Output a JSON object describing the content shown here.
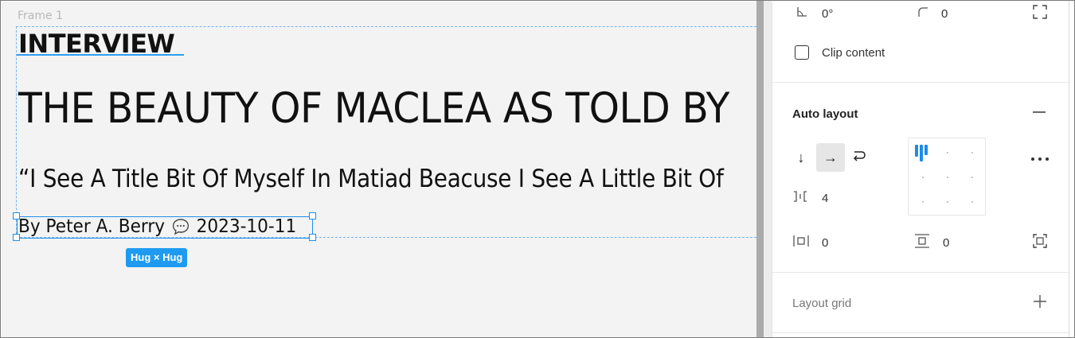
{
  "canvas": {
    "frame_label": "Frame 1",
    "kicker": "INTERVIEW",
    "headline": "THE BEAUTY OF MACLEA AS TOLD BY",
    "quote": "“I See A Title Bit Of Myself In Matiad Beacuse I See A Little Bit Of",
    "byline": {
      "author": "By Peter A. Berry",
      "date": "2023-10-11"
    },
    "selection_badge": "Hug × Hug"
  },
  "panel": {
    "transform": {
      "rotation": "0°",
      "corner_radius": "0"
    },
    "clip_content_label": "Clip content",
    "clip_content_checked": false,
    "auto_layout": {
      "title": "Auto layout",
      "direction": "horizontal",
      "gap": "4",
      "padding_horizontal": "0",
      "padding_vertical": "0",
      "alignment": "top-left"
    },
    "layout_grid": {
      "title": "Layout grid"
    }
  },
  "colors": {
    "selection": "#1e90ee",
    "guide": "#74b6ee",
    "canvas_bg": "#f3f3f3"
  }
}
